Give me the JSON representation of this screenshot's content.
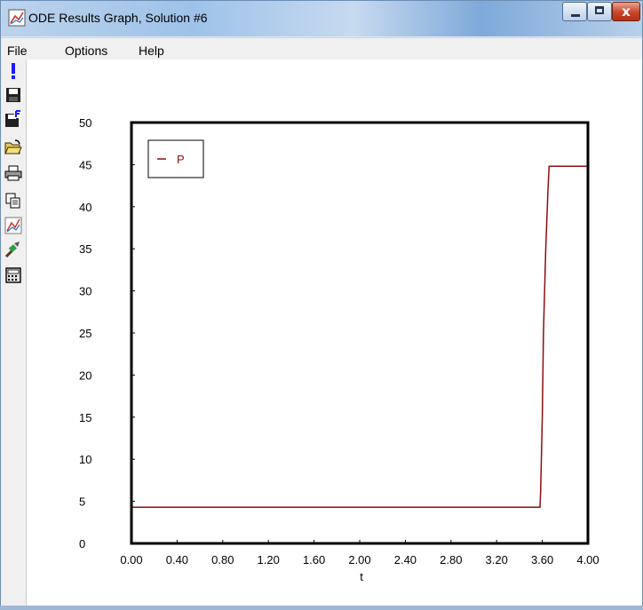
{
  "window": {
    "title": "ODE Results Graph, Solution #6",
    "close_glyph": "x"
  },
  "menu": {
    "items": [
      {
        "label": "File"
      },
      {
        "label": "Options"
      },
      {
        "label": "Help"
      }
    ]
  },
  "toolbar": {
    "icons": [
      "exclamation-icon",
      "save-icon",
      "save-format-icon",
      "open-folder-icon",
      "print-icon",
      "copy-icon",
      "graph-icon",
      "brush-icon",
      "calculator-icon"
    ]
  },
  "colors": {
    "series": "#8b0f0f",
    "frame": "#000000"
  },
  "chart_data": {
    "type": "line",
    "xlabel": "t",
    "ylabel": "",
    "xlim": [
      0,
      4
    ],
    "ylim": [
      0,
      50
    ],
    "x_ticks": [
      "0.00",
      "0.40",
      "0.80",
      "1.20",
      "1.60",
      "2.00",
      "2.40",
      "2.80",
      "3.20",
      "3.60",
      "4.00"
    ],
    "y_ticks": [
      "0",
      "5",
      "10",
      "15",
      "20",
      "25",
      "30",
      "35",
      "40",
      "45",
      "50"
    ],
    "legend": {
      "position": "top-left",
      "entries": [
        "P"
      ]
    },
    "series": [
      {
        "name": "P",
        "color": "#8b0f0f",
        "x": [
          0,
          3.58,
          3.585,
          3.6,
          3.61,
          3.63,
          3.65,
          3.66,
          4.0
        ],
        "y": [
          4.3,
          4.3,
          6,
          15,
          25,
          35,
          42,
          44.8,
          44.8
        ]
      }
    ]
  }
}
